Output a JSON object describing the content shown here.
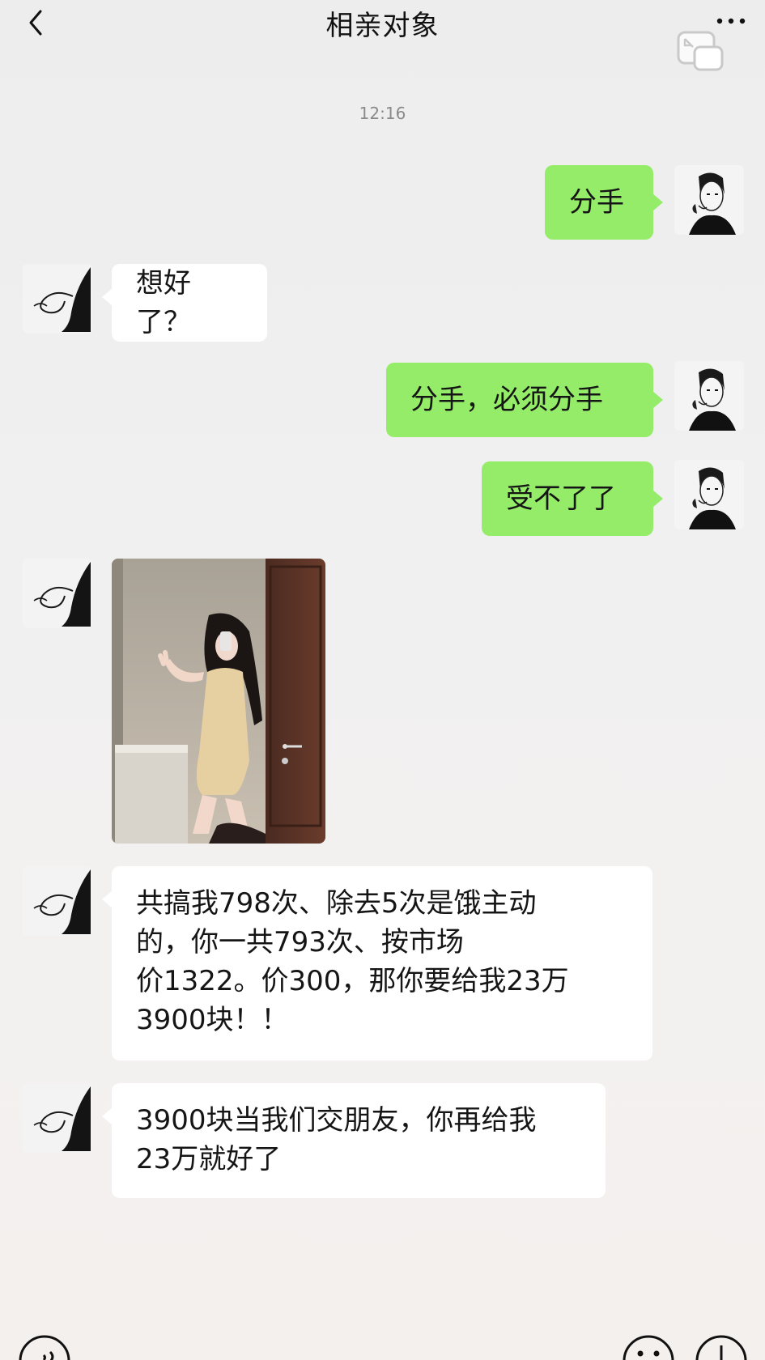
{
  "header": {
    "title": "相亲对象",
    "back_icon": "chevron-left-icon",
    "more_icon": "more-dots-icon",
    "float_icon": "floating-window-icon"
  },
  "timestamp": "12:16",
  "messages": [
    {
      "sender": "me",
      "text": "分手"
    },
    {
      "sender": "them",
      "text": "想好了？"
    },
    {
      "sender": "me",
      "text": "分手，必须分手"
    },
    {
      "sender": "me",
      "text": "受不了了"
    },
    {
      "sender": "them",
      "type": "image",
      "text": ""
    },
    {
      "sender": "them",
      "lines": [
        "共搞我798次、除去5次是饿主动",
        "的，你一共793次、按市场",
        "价1322。价300，那你要给我23万",
        "3900块！！"
      ]
    },
    {
      "sender": "them",
      "lines": [
        "3900块当我们交朋友，你再给我",
        "23万就好了"
      ]
    }
  ],
  "bottom_bar": {
    "voice_icon": "voice-input-icon",
    "emoji_icon": "emoji-icon",
    "plus_icon": "plus-icon"
  },
  "colors": {
    "me_bubble": "#95ec69",
    "them_bubble": "#ffffff",
    "background": "#efefef"
  }
}
